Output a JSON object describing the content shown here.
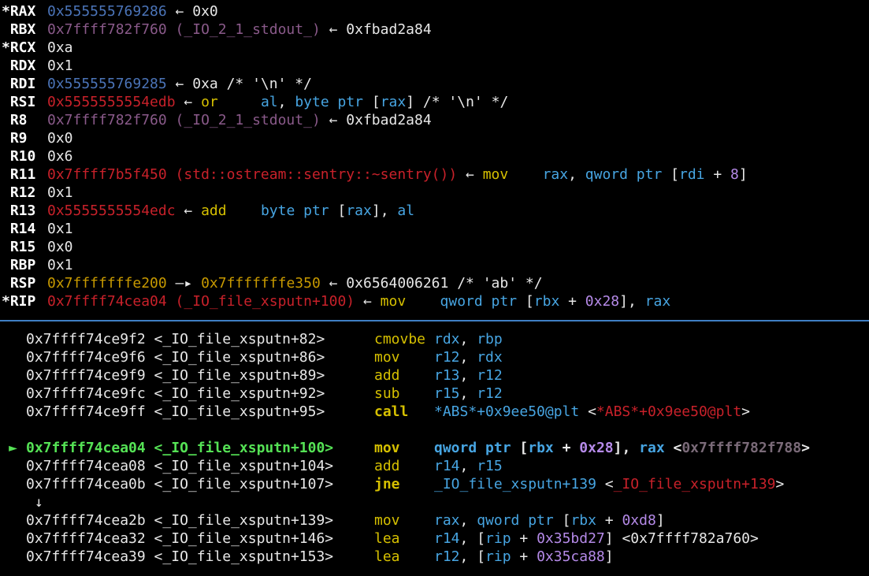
{
  "colors": {
    "divider": "#3f7fc4",
    "stack": "#4b74b8",
    "code": "#c8212a",
    "data": "#8a5a8a",
    "heap_stack": "#c79900",
    "mnemonic": "#d6c000",
    "register": "#47a5e2",
    "immediate": "#b58ae8",
    "current_line": "#55e255"
  },
  "registers": [
    {
      "name": "*RAX",
      "parts": [
        {
          "t": "0x555555769286",
          "c": "blue"
        },
        {
          "t": " ← 0x0",
          "c": "plain"
        }
      ]
    },
    {
      "name": " RBX",
      "parts": [
        {
          "t": "0x7ffff782f760 (_IO_2_1_stdout_)",
          "c": "purple"
        },
        {
          "t": " ← 0xfbad2a84",
          "c": "plain"
        }
      ]
    },
    {
      "name": "*RCX",
      "parts": [
        {
          "t": "0xa",
          "c": "plain"
        }
      ]
    },
    {
      "name": " RDX",
      "parts": [
        {
          "t": "0x1",
          "c": "plain"
        }
      ]
    },
    {
      "name": " RDI",
      "parts": [
        {
          "t": "0x555555769285",
          "c": "blue"
        },
        {
          "t": " ← 0xa /* '\\n' */",
          "c": "plain"
        }
      ]
    },
    {
      "name": " RSI",
      "parts": [
        {
          "t": "0x5555555554edb",
          "c": "red"
        },
        {
          "t": " ← ",
          "c": "plain"
        },
        {
          "t": "or",
          "c": "yellow"
        },
        {
          "t": "     ",
          "c": "plain"
        },
        {
          "t": "al",
          "c": "cyan"
        },
        {
          "t": ", ",
          "c": "plain"
        },
        {
          "t": "byte ptr",
          "c": "cyan"
        },
        {
          "t": " [",
          "c": "plain"
        },
        {
          "t": "rax",
          "c": "cyan"
        },
        {
          "t": "] /* '\\n' */",
          "c": "plain"
        }
      ]
    },
    {
      "name": " R8",
      "parts": [
        {
          "t": "0x7ffff782f760 (_IO_2_1_stdout_)",
          "c": "purple"
        },
        {
          "t": " ← 0xfbad2a84",
          "c": "plain"
        }
      ]
    },
    {
      "name": " R9",
      "parts": [
        {
          "t": "0x0",
          "c": "plain"
        }
      ]
    },
    {
      "name": " R10",
      "parts": [
        {
          "t": "0x6",
          "c": "plain"
        }
      ]
    },
    {
      "name": " R11",
      "parts": [
        {
          "t": "0x7ffff7b5f450 (std::ostream::sentry::~sentry())",
          "c": "red"
        },
        {
          "t": " ← ",
          "c": "plain"
        },
        {
          "t": "mov",
          "c": "yellow"
        },
        {
          "t": "    ",
          "c": "plain"
        },
        {
          "t": "rax",
          "c": "cyan"
        },
        {
          "t": ", ",
          "c": "plain"
        },
        {
          "t": "qword ptr",
          "c": "cyan"
        },
        {
          "t": " [",
          "c": "plain"
        },
        {
          "t": "rdi",
          "c": "cyan"
        },
        {
          "t": " + ",
          "c": "plain"
        },
        {
          "t": "8",
          "c": "num"
        },
        {
          "t": "]",
          "c": "plain"
        }
      ]
    },
    {
      "name": " R12",
      "parts": [
        {
          "t": "0x1",
          "c": "plain"
        }
      ]
    },
    {
      "name": " R13",
      "parts": [
        {
          "t": "0x5555555554edc",
          "c": "red"
        },
        {
          "t": " ← ",
          "c": "plain"
        },
        {
          "t": "add",
          "c": "yellow"
        },
        {
          "t": "    ",
          "c": "plain"
        },
        {
          "t": "byte ptr",
          "c": "cyan"
        },
        {
          "t": " [",
          "c": "plain"
        },
        {
          "t": "rax",
          "c": "cyan"
        },
        {
          "t": "], ",
          "c": "plain"
        },
        {
          "t": "al",
          "c": "cyan"
        }
      ]
    },
    {
      "name": " R14",
      "parts": [
        {
          "t": "0x1",
          "c": "plain"
        }
      ]
    },
    {
      "name": " R15",
      "parts": [
        {
          "t": "0x0",
          "c": "plain"
        }
      ]
    },
    {
      "name": " RBP",
      "parts": [
        {
          "t": "0x1",
          "c": "plain"
        }
      ]
    },
    {
      "name": " RSP",
      "parts": [
        {
          "t": "0x7fffffffe200",
          "c": "orange"
        },
        {
          "t": " —▸ ",
          "c": "plain"
        },
        {
          "t": "0x7fffffffe350",
          "c": "orange"
        },
        {
          "t": " ← 0x6564006261 /* 'ab' */",
          "c": "plain"
        }
      ]
    },
    {
      "name": "*RIP",
      "parts": [
        {
          "t": "0x7ffff74cea04 (_IO_file_xsputn+100)",
          "c": "red"
        },
        {
          "t": " ← ",
          "c": "plain"
        },
        {
          "t": "mov",
          "c": "yellow"
        },
        {
          "t": "    ",
          "c": "plain"
        },
        {
          "t": "qword ptr",
          "c": "cyan"
        },
        {
          "t": " [",
          "c": "plain"
        },
        {
          "t": "rbx",
          "c": "cyan"
        },
        {
          "t": " + ",
          "c": "plain"
        },
        {
          "t": "0x28",
          "c": "num"
        },
        {
          "t": "], ",
          "c": "plain"
        },
        {
          "t": "rax",
          "c": "cyan"
        }
      ]
    }
  ],
  "disasm": [
    {
      "arrow": "",
      "addr": "0x7ffff74ce9f2 <_IO_file_xsputn+82>",
      "mnem": "cmovbe",
      "ops": [
        {
          "t": "rdx",
          "c": "cyan"
        },
        {
          "t": ", ",
          "c": "plain"
        },
        {
          "t": "rbp",
          "c": "cyan"
        }
      ]
    },
    {
      "arrow": "",
      "addr": "0x7ffff74ce9f6 <_IO_file_xsputn+86>",
      "mnem": "mov",
      "ops": [
        {
          "t": "r12",
          "c": "cyan"
        },
        {
          "t": ", ",
          "c": "plain"
        },
        {
          "t": "rdx",
          "c": "cyan"
        }
      ]
    },
    {
      "arrow": "",
      "addr": "0x7ffff74ce9f9 <_IO_file_xsputn+89>",
      "mnem": "add",
      "ops": [
        {
          "t": "r13",
          "c": "cyan"
        },
        {
          "t": ", ",
          "c": "plain"
        },
        {
          "t": "r12",
          "c": "cyan"
        }
      ]
    },
    {
      "arrow": "",
      "addr": "0x7ffff74ce9fc <_IO_file_xsputn+92>",
      "mnem": "sub",
      "ops": [
        {
          "t": "r15",
          "c": "cyan"
        },
        {
          "t": ", ",
          "c": "plain"
        },
        {
          "t": "r12",
          "c": "cyan"
        }
      ]
    },
    {
      "arrow": "",
      "addr": "0x7ffff74ce9ff <_IO_file_xsputn+95>",
      "mnem": "call",
      "ops": [
        {
          "t": "*ABS*+0x9ee50@plt",
          "c": "cyan"
        },
        {
          "t": " <",
          "c": "plain"
        },
        {
          "t": "*ABS*+0x9ee50@plt",
          "c": "red"
        },
        {
          "t": ">",
          "c": "plain"
        }
      ]
    },
    {
      "blank": true
    },
    {
      "arrow": "►",
      "current": true,
      "addr": "0x7ffff74cea04 <_IO_file_xsputn+100>",
      "mnem": "mov",
      "ops": [
        {
          "t": "qword ptr",
          "c": "cyan"
        },
        {
          "t": " [",
          "c": "plain"
        },
        {
          "t": "rbx",
          "c": "cyan"
        },
        {
          "t": " + ",
          "c": "plain"
        },
        {
          "t": "0x28",
          "c": "num"
        },
        {
          "t": "], ",
          "c": "plain"
        },
        {
          "t": "rax",
          "c": "cyan"
        },
        {
          "t": " <",
          "c": "plain"
        },
        {
          "t": "0x7ffff782f788",
          "c": "dim"
        },
        {
          "t": ">",
          "c": "plain"
        }
      ]
    },
    {
      "arrow": "",
      "addr": "0x7ffff74cea08 <_IO_file_xsputn+104>",
      "mnem": "add",
      "ops": [
        {
          "t": "r14",
          "c": "cyan"
        },
        {
          "t": ", ",
          "c": "plain"
        },
        {
          "t": "r15",
          "c": "cyan"
        }
      ]
    },
    {
      "arrow": "",
      "addr": "0x7ffff74cea0b <_IO_file_xsputn+107>",
      "mnem": "jne",
      "ops": [
        {
          "t": "_IO_file_xsputn+139",
          "c": "cyan"
        },
        {
          "t": " <",
          "c": "plain"
        },
        {
          "t": "_IO_file_xsputn+139",
          "c": "red"
        },
        {
          "t": ">",
          "c": "plain"
        }
      ]
    },
    {
      "jump": "↓"
    },
    {
      "arrow": "",
      "addr": "0x7ffff74cea2b <_IO_file_xsputn+139>",
      "mnem": "mov",
      "ops": [
        {
          "t": "rax",
          "c": "cyan"
        },
        {
          "t": ", ",
          "c": "plain"
        },
        {
          "t": "qword ptr",
          "c": "cyan"
        },
        {
          "t": " [",
          "c": "plain"
        },
        {
          "t": "rbx",
          "c": "cyan"
        },
        {
          "t": " + ",
          "c": "plain"
        },
        {
          "t": "0xd8",
          "c": "num"
        },
        {
          "t": "]",
          "c": "plain"
        }
      ]
    },
    {
      "arrow": "",
      "addr": "0x7ffff74cea32 <_IO_file_xsputn+146>",
      "mnem": "lea",
      "ops": [
        {
          "t": "r14",
          "c": "cyan"
        },
        {
          "t": ", [",
          "c": "plain"
        },
        {
          "t": "rip",
          "c": "cyan"
        },
        {
          "t": " + ",
          "c": "plain"
        },
        {
          "t": "0x35bd27",
          "c": "num"
        },
        {
          "t": "] <0x7ffff782a760>",
          "c": "plain"
        }
      ]
    },
    {
      "arrow": "",
      "addr": "0x7ffff74cea39 <_IO_file_xsputn+153>",
      "mnem": "lea",
      "ops": [
        {
          "t": "r12",
          "c": "cyan"
        },
        {
          "t": ", [",
          "c": "plain"
        },
        {
          "t": "rip",
          "c": "cyan"
        },
        {
          "t": " + ",
          "c": "plain"
        },
        {
          "t": "0x35ca88",
          "c": "num"
        },
        {
          "t": "]",
          "c": "plain"
        }
      ]
    }
  ]
}
